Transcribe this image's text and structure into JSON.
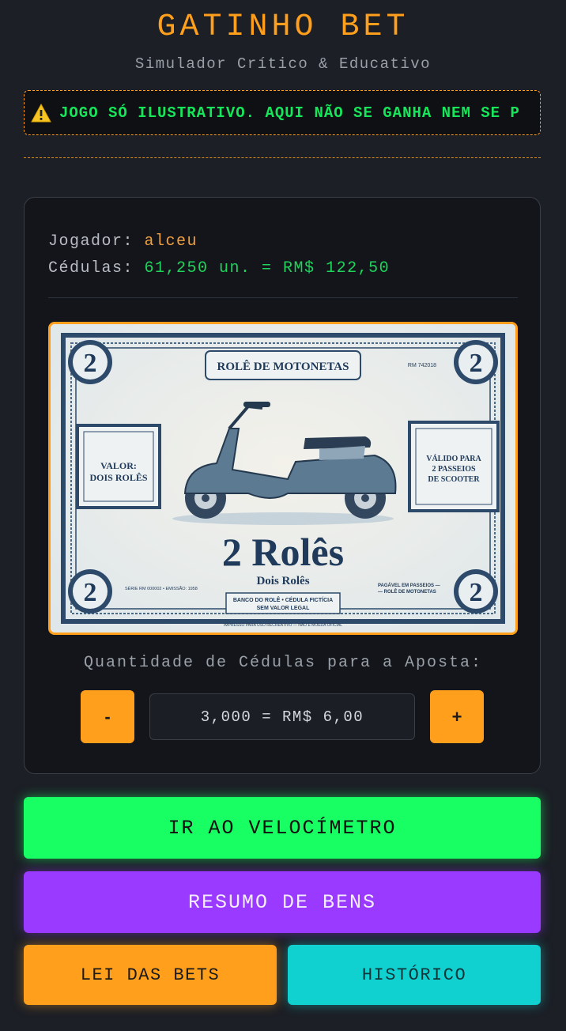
{
  "header": {
    "title": "GATINHO BET",
    "subtitle": "Simulador Crítico & Educativo"
  },
  "ticker": {
    "icon": "warning-icon",
    "text": "JOGO SÓ ILUSTRATIVO. AQUI NÃO SE GANHA NEM SE P"
  },
  "player_card": {
    "player_label": "Jogador:",
    "player_name": "alceu",
    "notes_label": "Cédulas:",
    "notes_value": "61,250 un. = RM$ 122,50"
  },
  "banknote": {
    "header": "ROLÊ DE MOTONETAS",
    "serial": "RM 742018",
    "left_box": [
      "VALOR:",
      "DOIS ROLÊS"
    ],
    "right_box": [
      "VÁLIDO PARA",
      "2 PASSEIOS",
      "DE SCOOTER"
    ],
    "big_value": "2 Rolês",
    "sub_value": "Dois Rolês",
    "corner_numeral": "2",
    "series_info": "SÉRIE RM 000002 • EMISSÃO: 1958",
    "bank_line_1": "BANCO DO ROLÊ • CÉDULA FICTÍCIA",
    "bank_line_2": "SEM VALOR LEGAL",
    "payable_1": "PAGÁVEL EM PASSEIOS —",
    "payable_2": "— ROLÊ DE MOTONETAS",
    "footer": "IMPRESSO PARA USO RECREATIVO — NÃO É MOEDA OFICIAL"
  },
  "bet": {
    "label": "Quantidade de Cédulas para a Aposta:",
    "minus_label": "-",
    "plus_label": "+",
    "value": "3,000 = RM$ 6,00"
  },
  "actions": {
    "speedometer": "IR AO VELOCÍMETRO",
    "assets": "RESUMO DE BENS",
    "bets_law": "LEI DAS BETS",
    "history": "HISTÓRICO"
  },
  "colors": {
    "accent": "#ff9f1c",
    "green": "#17ff63",
    "purple": "#9a39ff",
    "teal": "#10d0d0",
    "background": "#1c1f26"
  }
}
